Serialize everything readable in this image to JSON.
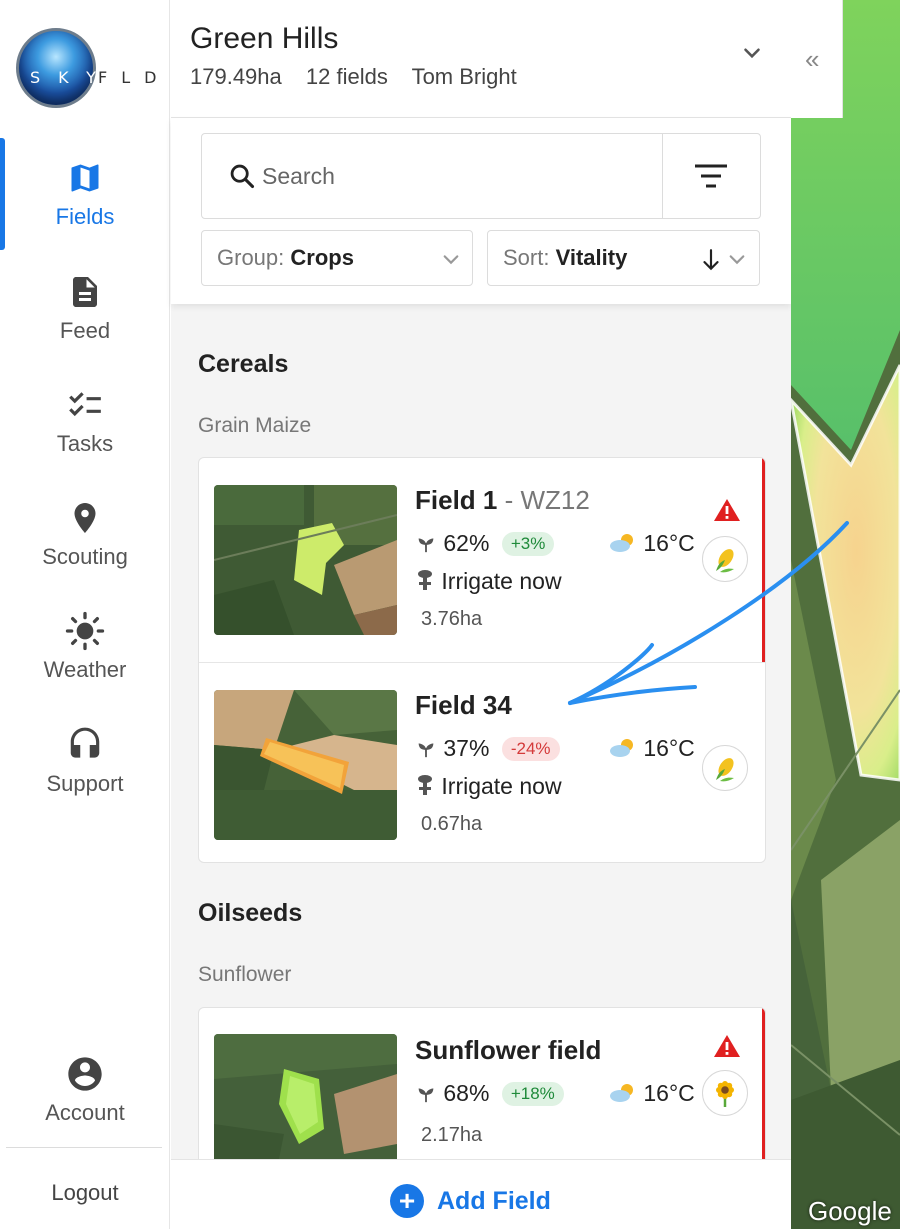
{
  "brand": {
    "letters_a": "SKY",
    "letters_b": "FLD"
  },
  "nav": {
    "items": [
      {
        "label": "Fields",
        "icon": "map-icon"
      },
      {
        "label": "Feed",
        "icon": "document-icon"
      },
      {
        "label": "Tasks",
        "icon": "checklist-icon"
      },
      {
        "label": "Scouting",
        "icon": "location-pin-icon"
      },
      {
        "label": "Weather",
        "icon": "sun-icon"
      },
      {
        "label": "Support",
        "icon": "headset-icon"
      },
      {
        "label": "Account",
        "icon": "user-icon"
      }
    ],
    "logout": "Logout"
  },
  "farm": {
    "name": "Green Hills",
    "area": "179.49ha",
    "field_count": "12 fields",
    "owner": "Tom Bright"
  },
  "search": {
    "placeholder": "Search"
  },
  "group_dropdown": {
    "label": "Group:",
    "value": "Crops"
  },
  "sort_dropdown": {
    "label": "Sort:",
    "value": "Vitality"
  },
  "groups": [
    {
      "title": "Cereals",
      "subgroup": "Grain Maize",
      "fields": [
        {
          "name": "Field 1",
          "code": "- WZ12",
          "vitality": "62%",
          "change": "+3%",
          "trend": "up",
          "temp": "16°C",
          "action": "Irrigate now",
          "area": "3.76ha",
          "alert": true,
          "crop_icon": "corn-icon"
        },
        {
          "name": "Field 34",
          "code": "",
          "vitality": "37%",
          "change": "-24%",
          "trend": "down",
          "temp": "16°C",
          "action": "Irrigate now",
          "area": "0.67ha",
          "alert": false,
          "crop_icon": "corn-icon"
        }
      ]
    },
    {
      "title": "Oilseeds",
      "subgroup": "Sunflower",
      "fields": [
        {
          "name": "Sunflower field",
          "code": "",
          "vitality": "68%",
          "change": "+18%",
          "trend": "up",
          "temp": "16°C",
          "action": "",
          "area": "2.17ha",
          "alert": true,
          "crop_icon": "sunflower-icon"
        }
      ]
    }
  ],
  "add_field": "Add Field",
  "map": {
    "collapse": "«",
    "attribution": "Google"
  },
  "colors": {
    "accent": "#1877e6",
    "alert": "#e02020",
    "positive": "#1f8a3a",
    "negative": "#d43a3a"
  }
}
